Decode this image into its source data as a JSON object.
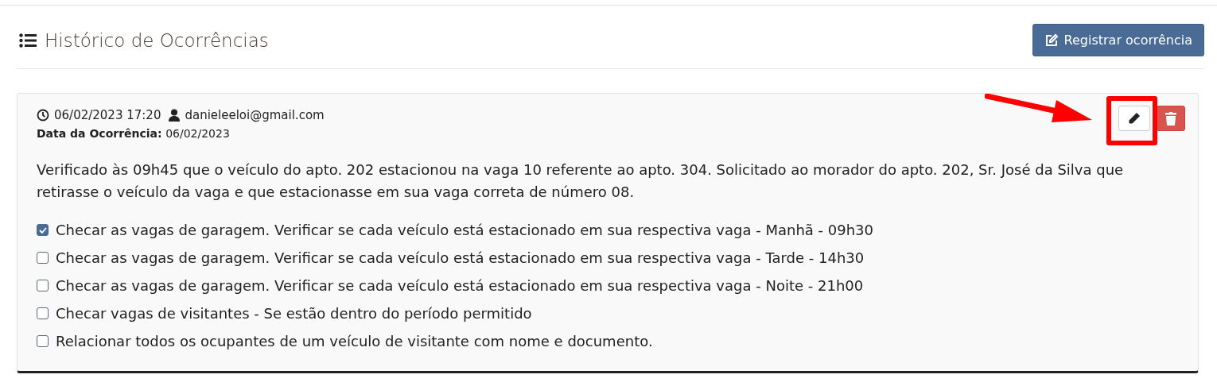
{
  "header": {
    "title": "Histórico de Ocorrências",
    "button": "Registrar ocorrência"
  },
  "occurrences": [
    {
      "timestamp": "06/02/2023 17:20",
      "user": "danieleeloi@gmail.com",
      "date_label": "Data da Ocorrência:",
      "date": "06/02/2023",
      "edit_highlighted": true,
      "description": "Verificado às 09h45 que o veículo do apto. 202 estacionou na vaga 10 referente ao apto. 304. Solicitado ao morador do apto. 202, Sr. José da Silva que retirasse o veículo da vaga e que estacionasse em sua vaga correta de número 08.",
      "checklist": [
        {
          "label": "Checar as vagas de garagem. Verificar se cada veículo está estacionado em sua respectiva vaga - Manhã - 09h30",
          "checked": true
        },
        {
          "label": "Checar as vagas de garagem. Verificar se cada veículo está estacionado em sua respectiva vaga - Tarde - 14h30",
          "checked": false
        },
        {
          "label": "Checar as vagas de garagem. Verificar se cada veículo está estacionado em sua respectiva vaga - Noite - 21h00",
          "checked": false
        },
        {
          "label": "Checar vagas de visitantes - Se estão dentro do período permitido",
          "checked": false
        },
        {
          "label": "Relacionar todos os ocupantes de um veículo de visitante com nome e documento.",
          "checked": false
        }
      ]
    }
  ]
}
